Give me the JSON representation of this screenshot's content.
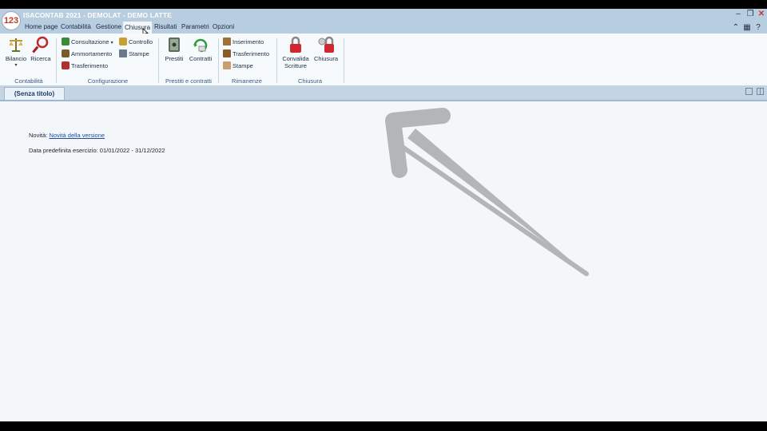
{
  "app": {
    "title": "ISACONTAB 2021 - DEMOLAT - DEMO LATTE",
    "logo_text": "123"
  },
  "menu": [
    "Home page",
    "Contabilità",
    "Gestione",
    "Chiusura",
    "Risultati",
    "Parametri",
    "Opzioni"
  ],
  "active_menu": "Chiusura",
  "ribbon": {
    "contabilita": {
      "label": "Contabilità",
      "bilancio": "Bilancio",
      "ricerca": "Ricerca"
    },
    "configurazione": {
      "label": "Configurazione",
      "consultazione": "Consultazione",
      "ammortamento": "Ammortamento",
      "trasferimento": "Trasferimento",
      "controllo": "Controllo",
      "stampe": "Stampe"
    },
    "prestiti": {
      "label": "Prestiti e contratti",
      "prestiti": "Prestiti",
      "contratti": "Contratti"
    },
    "rimanenze": {
      "label": "Rimanenze",
      "inserimento": "Inserimento",
      "trasferimento": "Trasferimento",
      "stampe": "Stampe"
    },
    "chiusura": {
      "label": "Chiusura",
      "convalida_1": "Convalida",
      "convalida_2": "Scritture",
      "chiusura": "Chiusura"
    }
  },
  "tab": {
    "title": "(Senza titolo)"
  },
  "content": {
    "novita_label": "Novità:",
    "novita_link": "Novità della versione",
    "data_label": "Data predefinita esercizio: 01/01/2022 - 31/12/2022"
  },
  "colors": {
    "header": "#b9cde0",
    "accent": "#1d4fa0",
    "arrow": "#b3b6b9"
  }
}
